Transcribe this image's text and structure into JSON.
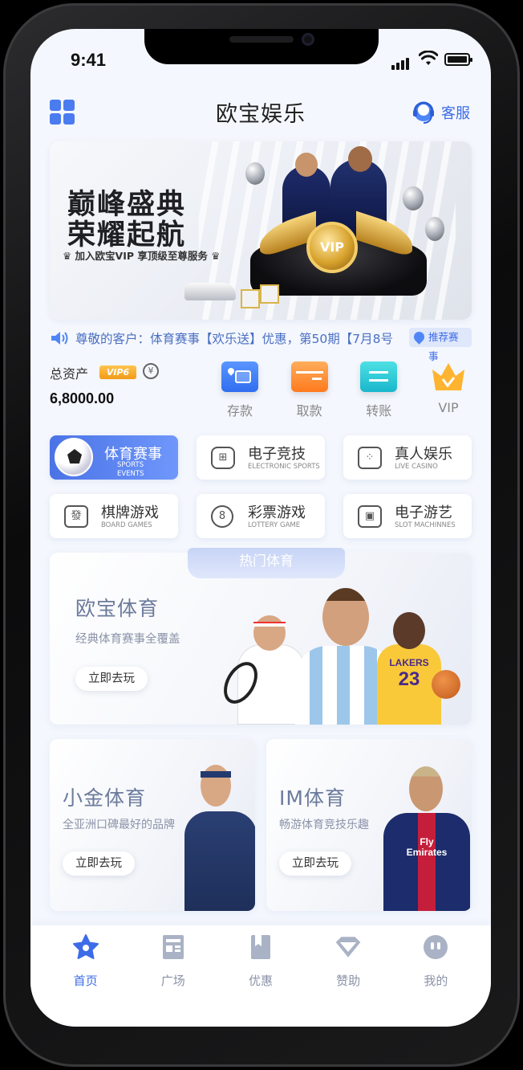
{
  "status_bar": {
    "time": "9:41"
  },
  "header": {
    "title": "欧宝娱乐",
    "service_label": "客服"
  },
  "banner": {
    "headline_line1": "巅峰盛典",
    "headline_line2": "荣耀起航",
    "subline": "♛ 加入欧宝VIP 享顶级至尊服务 ♛",
    "emblem": "VIP"
  },
  "notice": {
    "text": "尊敬的客户：体育赛事【欢乐送】优惠，第50期【7月8号",
    "tag": "推荐赛事"
  },
  "account": {
    "label": "总资产",
    "vip_level": "VIP6",
    "refresh_symbol": "¥",
    "amount": "6,8000.00"
  },
  "quick_actions": [
    {
      "label": "存款",
      "icon": "deposit-card-icon",
      "color": "#3d7cf5"
    },
    {
      "label": "取款",
      "icon": "withdraw-card-icon",
      "color": "#ff8a2a"
    },
    {
      "label": "转账",
      "icon": "transfer-icon",
      "color": "#22c3d2"
    },
    {
      "label": "VIP",
      "icon": "vip-crown-icon",
      "color": "#ffa423"
    }
  ],
  "game_categories": [
    {
      "name": "体育赛事",
      "sub": "SPORTS EVENTS",
      "icon": "soccer-ball-icon",
      "active": true
    },
    {
      "name": "电子竞技",
      "sub": "ELECTRONIC SPORTS",
      "icon": "gamepad-icon",
      "glyph": "⊞"
    },
    {
      "name": "真人娱乐",
      "sub": "LIVE CASINO",
      "icon": "dice-icon",
      "glyph": "⁘"
    },
    {
      "name": "棋牌游戏",
      "sub": "BOARD GAMES",
      "icon": "chess-piece-icon",
      "glyph": "發"
    },
    {
      "name": "彩票游戏",
      "sub": "LOTTERY GAME",
      "icon": "lottery-ball-icon",
      "glyph": "8"
    },
    {
      "name": "电子游艺",
      "sub": "SLOT MACHINNES",
      "icon": "slot-machine-icon",
      "glyph": "▣"
    }
  ],
  "hot_sports": {
    "tab_label": "热门体育",
    "main": {
      "title": "欧宝体育",
      "subtitle": "经典体育赛事全覆盖",
      "button": "立即去玩"
    },
    "cards": [
      {
        "title": "小金体育",
        "subtitle": "全亚洲口碑最好的品牌",
        "button": "立即去玩"
      },
      {
        "title": "IM体育",
        "subtitle": "畅游体育竞技乐趣",
        "button": "立即去玩"
      }
    ],
    "jersey_texts": {
      "lakers": "LAKERS",
      "lakers_number": "23",
      "psg_sponsor": "Fly Emirates"
    }
  },
  "tab_bar": [
    {
      "label": "首页",
      "icon": "home-star-icon",
      "active": true
    },
    {
      "label": "广场",
      "icon": "square-news-icon"
    },
    {
      "label": "优惠",
      "icon": "promo-bookmark-icon"
    },
    {
      "label": "赞助",
      "icon": "sponsor-diamond-icon"
    },
    {
      "label": "我的",
      "icon": "profile-face-icon"
    }
  ],
  "colors": {
    "accent": "#3d6ce8",
    "background": "#f4f7fd"
  }
}
